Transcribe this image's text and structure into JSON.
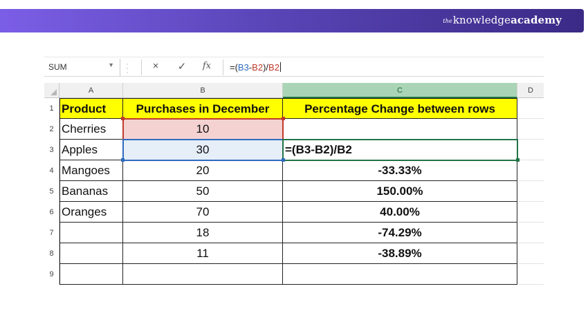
{
  "brand": {
    "the": "the",
    "knowledge": "knowledge",
    "academy": "academy"
  },
  "formula_bar": {
    "name_box": "SUM",
    "formula_prefix": "=(",
    "formula_ref1": "B3",
    "formula_mid": "-",
    "formula_ref2": "B2",
    "formula_mid2": ")/",
    "formula_ref3": "B2",
    "cancel_icon": "×",
    "enter_icon": "✓",
    "fx_icon": "fx"
  },
  "columns": [
    "A",
    "B",
    "C",
    "D"
  ],
  "rows": [
    {
      "num": "1",
      "a": "Product",
      "b": "Purchases in December",
      "c": "Percentage Change between rows"
    },
    {
      "num": "2",
      "a": "Cherries",
      "b": "10",
      "c": ""
    },
    {
      "num": "3",
      "a": "Apples",
      "b": "30",
      "c": "=(B3-B2)/B2"
    },
    {
      "num": "4",
      "a": "Mangoes",
      "b": "20",
      "c": "-33.33%"
    },
    {
      "num": "5",
      "a": "Bananas",
      "b": "50",
      "c": "150.00%"
    },
    {
      "num": "6",
      "a": "Oranges",
      "b": "70",
      "c": "40.00%"
    },
    {
      "num": "7",
      "a": "",
      "b": "18",
      "c": "-74.29%"
    },
    {
      "num": "8",
      "a": "",
      "b": "11",
      "c": "-38.89%"
    },
    {
      "num": "9",
      "a": "",
      "b": "",
      "c": ""
    }
  ],
  "colors": {
    "banner_start": "#7b5ee6",
    "banner_end": "#3b2a86",
    "header_fill": "#ffff00",
    "ref_b2": "#c0392b",
    "ref_b3": "#2e6bbf",
    "active_cell": "#217346"
  }
}
